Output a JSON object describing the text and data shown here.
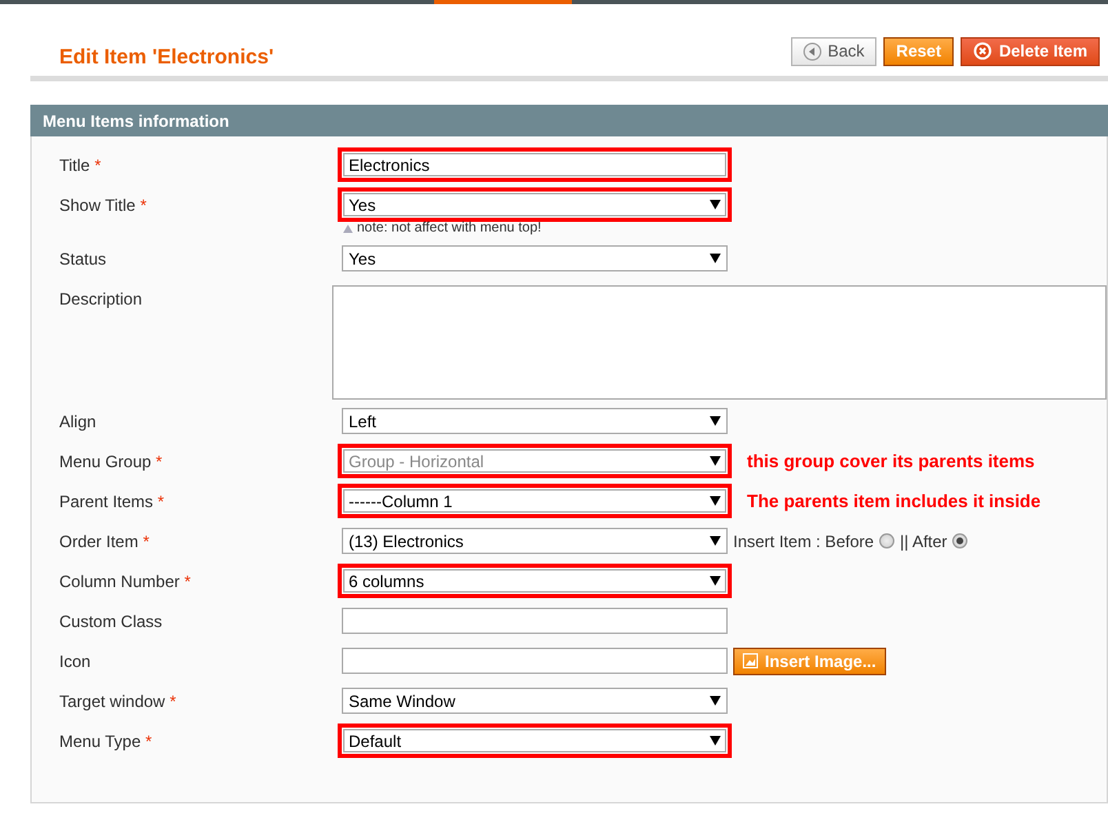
{
  "page_title": "Edit Item 'Electronics'",
  "buttons": [
    {
      "kind": "back",
      "label": "Back"
    },
    {
      "kind": "reset",
      "label": "Reset"
    },
    {
      "kind": "delete",
      "label": "Delete Item"
    }
  ],
  "section": {
    "title": "Menu Items information"
  },
  "fields": [
    {
      "kind": "text",
      "label": "Title",
      "required_mark": "*",
      "value": "Electronics",
      "highlighted": true
    },
    {
      "kind": "select",
      "label": "Show Title",
      "required_mark": "*",
      "value": "Yes",
      "highlighted": true,
      "note": "note: not affect with menu top!"
    },
    {
      "kind": "select",
      "label": "Status",
      "value": "Yes",
      "highlighted": false
    },
    {
      "kind": "textarea",
      "label": "Description"
    },
    {
      "kind": "select",
      "label": "Align",
      "value": "Left",
      "highlighted": false
    },
    {
      "kind": "select",
      "label": "Menu Group",
      "required_mark": "*",
      "value": "Group - Horizontal",
      "highlighted": true,
      "disabled": true,
      "annotation": "this group cover its parents items"
    },
    {
      "kind": "select",
      "label": "Parent Items",
      "required_mark": "*",
      "value": "------Column 1",
      "highlighted": true,
      "annotation": "The parents item includes it inside"
    },
    {
      "kind": "order",
      "label": "Order Item",
      "required_mark": "*",
      "value": "(13) Electronics",
      "highlighted": false,
      "insert_label": "Insert Item : Before",
      "separator": "|| After",
      "options": [
        {
          "selected": false
        },
        {
          "selected": true
        }
      ]
    },
    {
      "kind": "select",
      "label": "Column Number",
      "required_mark": "*",
      "value": "6 columns",
      "highlighted": true
    },
    {
      "kind": "text",
      "label": "Custom Class",
      "highlighted": false
    },
    {
      "kind": "image",
      "label": "Icon",
      "highlighted": false,
      "button": "Insert Image..."
    },
    {
      "kind": "select",
      "label": "Target window",
      "required_mark": "*",
      "value": "Same Window",
      "highlighted": false
    },
    {
      "kind": "select",
      "label": "Menu Type",
      "required_mark": "*",
      "value": "Default",
      "highlighted": true
    }
  ]
}
